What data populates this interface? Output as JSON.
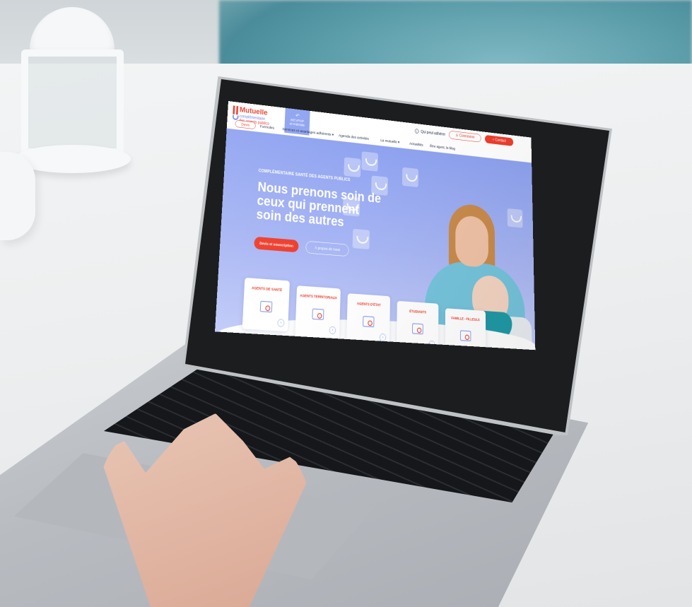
{
  "site": {
    "logo": {
      "name": "Mutuelle",
      "line1": "complémentaire",
      "line2": "des agents publics"
    },
    "mcvpap": {
      "label": "MCVPAP",
      "sub": "et Intériale"
    },
    "header": {
      "devis": "Devis",
      "qui_peut_adherer": "Qui peut adhérer",
      "connexion": "Connexion",
      "contact": "Contact"
    },
    "nav": [
      "Formules",
      "Services et avantages adhérents ▾",
      "Agenda des activités",
      "La mutuelle ▾",
      "Actualités",
      "Être agent, la blog"
    ],
    "hero": {
      "tagline": "COMPLÉMENTAIRE SANTÉ DES AGENTS PUBLICS",
      "title": "Nous prenons soin de ceux qui prennent soin des autres",
      "cta_primary": "Devis et souscription",
      "cta_secondary": "À propos de nous"
    },
    "cards": [
      {
        "label": "Agents de santé"
      },
      {
        "label": "Agents territoriaux"
      },
      {
        "label": "Agents d'état"
      },
      {
        "label": "Étudiants"
      },
      {
        "label": "Famille - filleuls"
      }
    ],
    "icons": [
      "info-icon",
      "user-icon",
      "chat-icon",
      "search-icon",
      "arrow-right-icon",
      "smiley-icon"
    ],
    "colors": {
      "brand_red": "#ef3e2d",
      "brand_blue": "#8ea2f0",
      "text_dark": "#1d2740"
    }
  }
}
